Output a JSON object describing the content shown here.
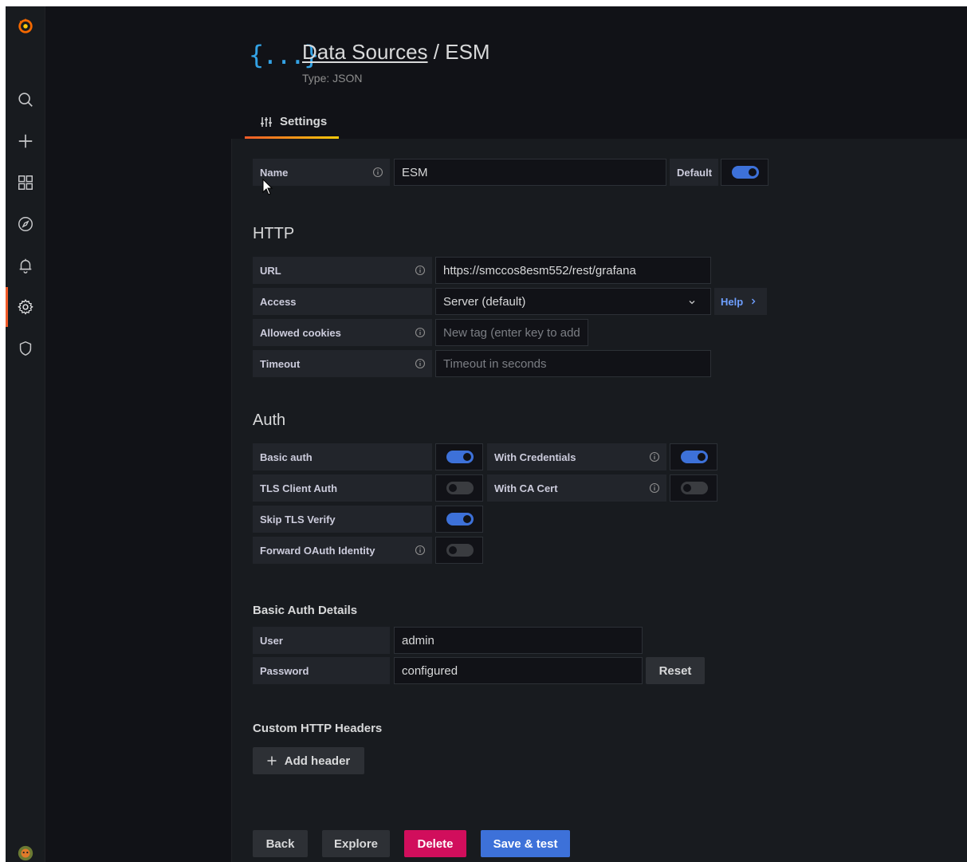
{
  "header": {
    "icon_glyph": "{...}",
    "breadcrumb_link": "Data Sources",
    "breadcrumb_sep": "/",
    "breadcrumb_current": "ESM",
    "subtitle": "Type: JSON"
  },
  "tabs": [
    {
      "label": "Settings",
      "active": true
    }
  ],
  "sidebar": {
    "items": [
      {
        "icon": "grafana-logo-icon"
      },
      {
        "icon": "search-icon"
      },
      {
        "icon": "plus-icon"
      },
      {
        "icon": "dashboards-icon"
      },
      {
        "icon": "explore-compass-icon"
      },
      {
        "icon": "alerting-bell-icon"
      },
      {
        "icon": "configuration-gear-icon",
        "active": true
      },
      {
        "icon": "shield-icon"
      },
      {
        "icon": "user-avatar-icon"
      }
    ],
    "active_color": "#f05a28"
  },
  "name_row": {
    "label": "Name",
    "value": "ESM",
    "default_label": "Default",
    "default_on": true
  },
  "http": {
    "heading": "HTTP",
    "url_label": "URL",
    "url_value": "https://smccos8esm552/rest/grafana",
    "access_label": "Access",
    "access_value": "Server (default)",
    "help_label": "Help",
    "cookies_label": "Allowed cookies",
    "cookies_placeholder": "New tag (enter key to add",
    "timeout_label": "Timeout",
    "timeout_placeholder": "Timeout in seconds"
  },
  "auth": {
    "heading": "Auth",
    "basic_auth_label": "Basic auth",
    "basic_auth_on": true,
    "with_credentials_label": "With Credentials",
    "with_credentials_on": true,
    "tls_client_label": "TLS Client Auth",
    "tls_client_on": false,
    "with_ca_label": "With CA Cert",
    "with_ca_on": false,
    "skip_tls_label": "Skip TLS Verify",
    "skip_tls_on": true,
    "forward_oauth_label": "Forward OAuth Identity",
    "forward_oauth_on": false
  },
  "basic_auth_details": {
    "heading": "Basic Auth Details",
    "user_label": "User",
    "user_value": "admin",
    "password_label": "Password",
    "password_value": "configured",
    "reset_label": "Reset"
  },
  "custom_headers": {
    "heading": "Custom HTTP Headers",
    "add_label": "Add header"
  },
  "actions": {
    "back": "Back",
    "explore": "Explore",
    "delete": "Delete",
    "save": "Save & test"
  },
  "colors": {
    "primary": "#3d71d9",
    "danger": "#d10e5c",
    "accent": "#f05a28",
    "background": "#111217"
  }
}
